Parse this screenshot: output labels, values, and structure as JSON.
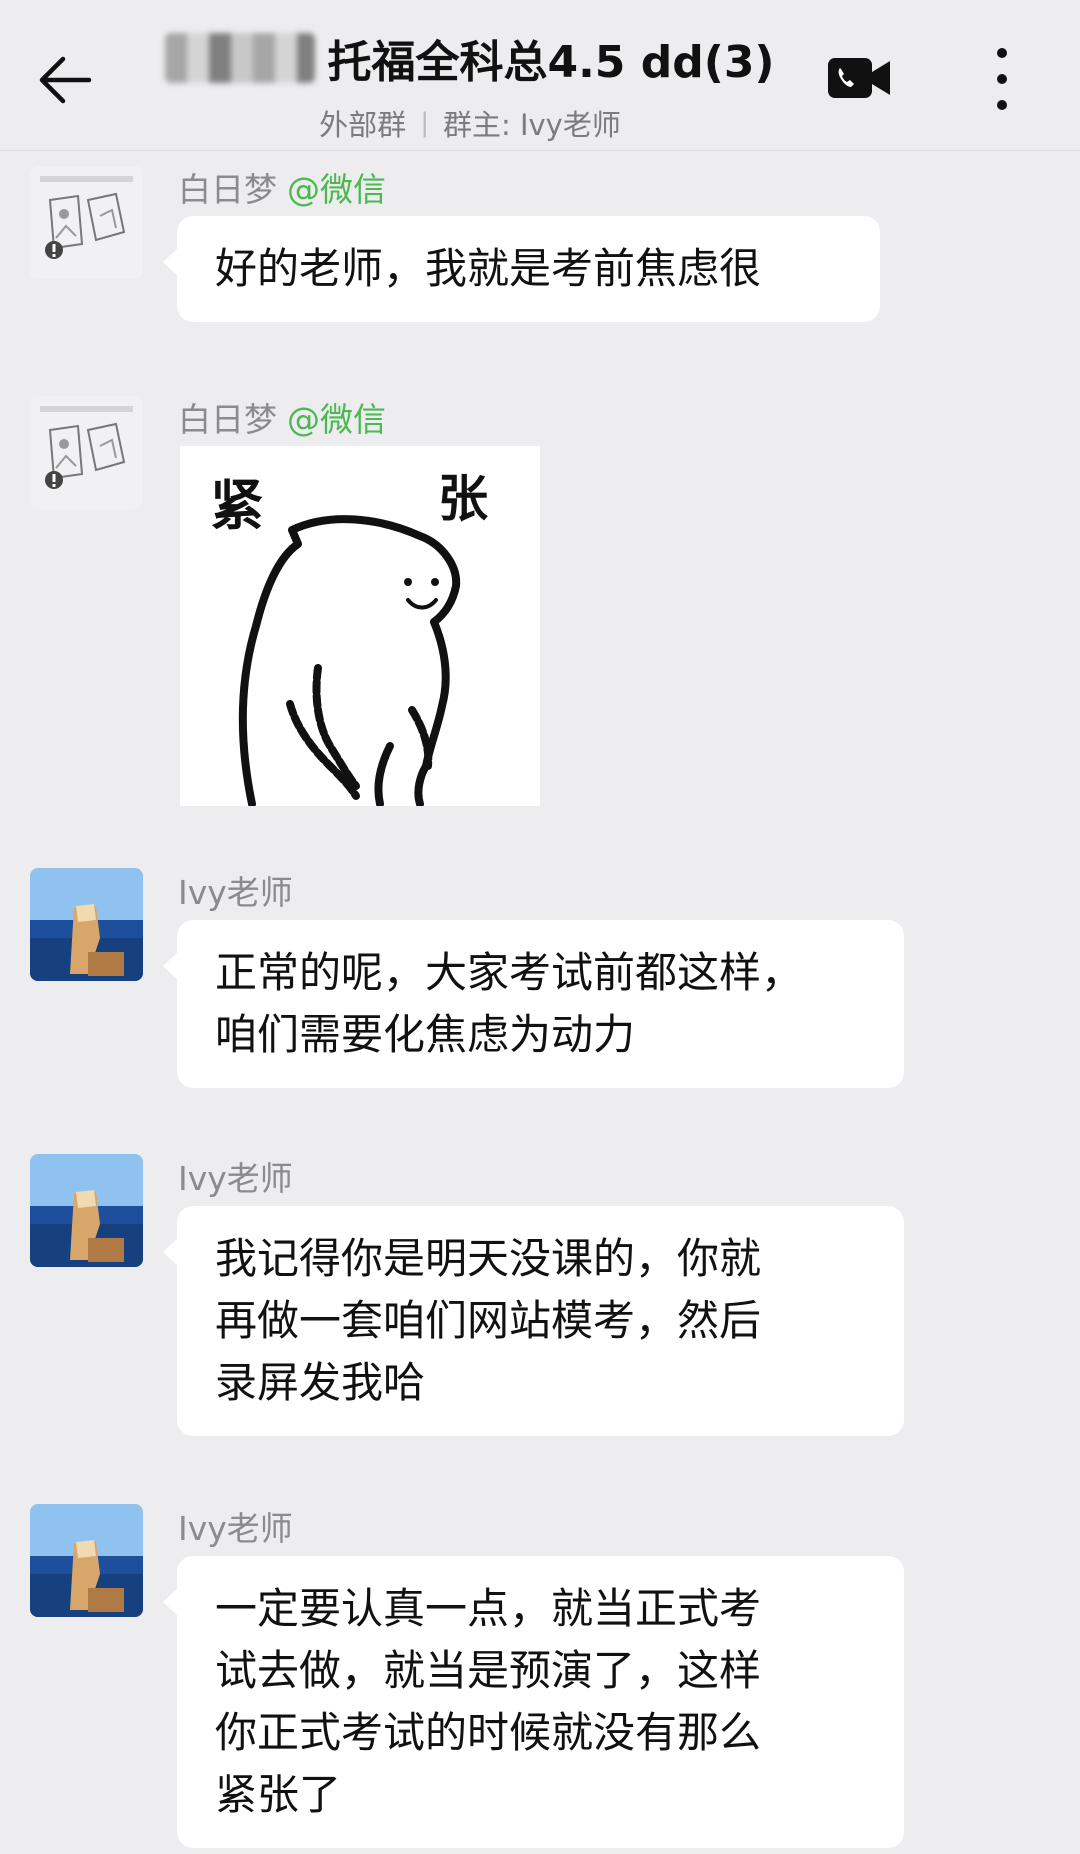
{
  "header": {
    "title": "托福全科总4.5 dd(3)",
    "subtitle_external": "外部群",
    "subtitle_separator": "|",
    "subtitle_owner": "群主: Ivy老师"
  },
  "messages": [
    {
      "sender": "白日梦",
      "tag": "@微信",
      "lines": [
        "好的老师，我就是考前焦虑很"
      ]
    },
    {
      "sender": "白日梦",
      "tag": "@微信",
      "sticker_text": [
        "紧",
        "张"
      ]
    },
    {
      "sender": "Ivy老师",
      "lines": [
        "正常的呢，大家考试前都这样，",
        "咱们需要化焦虑为动力"
      ]
    },
    {
      "sender": "Ivy老师",
      "lines": [
        "我记得你是明天没课的，你就",
        "再做一套咱们网站模考，然后",
        "录屏发我哈"
      ]
    },
    {
      "sender": "Ivy老师",
      "lines": [
        "一定要认真一点，就当正式考",
        "试去做，就当是预演了，这样",
        "你正式考试的时候就没有那么",
        "紧张了"
      ]
    }
  ],
  "icons": {
    "back": "arrow-left-icon",
    "video": "video-call-icon",
    "more": "more-vertical-icon",
    "broken_image": "broken-image-icon"
  },
  "colors": {
    "background": "#ededf0",
    "bubble": "#ffffff",
    "tag_green": "#4cb84f",
    "sender_gray": "#8a8a8f"
  }
}
